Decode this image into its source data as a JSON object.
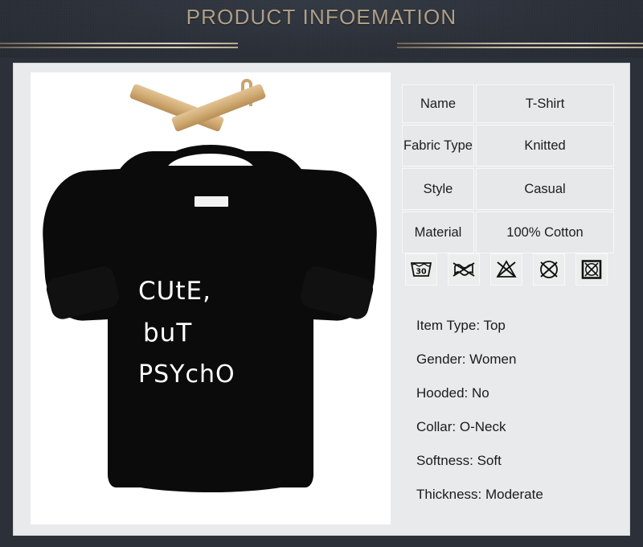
{
  "header": {
    "title": "PRODUCT INFOEMATION",
    "title_color": "#b09f86",
    "background_color": "#2b3039",
    "rule_color": "#c9bba4"
  },
  "product_image": {
    "alt_name": "black-t-shirt-on-wooden-hanger",
    "print_lines": [
      "CUtE,",
      "buT",
      "PSYchO"
    ],
    "shirt_color": "#0b0b0b",
    "hanger_color": "#cfa971",
    "background_color": "#ffffff"
  },
  "spec_table": {
    "rows": [
      {
        "key": "Name",
        "value": "T-Shirt"
      },
      {
        "key": "Fabric Type",
        "value": "Knitted"
      },
      {
        "key": "Style",
        "value": "Casual"
      },
      {
        "key": "Material",
        "value": "100% Cotton"
      }
    ]
  },
  "care_icons": [
    {
      "name": "wash-30-icon",
      "label": "30"
    },
    {
      "name": "do-not-wring-icon",
      "label": ""
    },
    {
      "name": "do-not-bleach-icon",
      "label": ""
    },
    {
      "name": "do-not-dry-clean-icon",
      "label": ""
    },
    {
      "name": "do-not-tumble-dry-icon",
      "label": ""
    }
  ],
  "attributes": [
    "Item Type: Top",
    "Gender: Women",
    "Hooded: No",
    "Collar: O-Neck",
    "Softness: Soft",
    "Thickness: Moderate"
  ]
}
